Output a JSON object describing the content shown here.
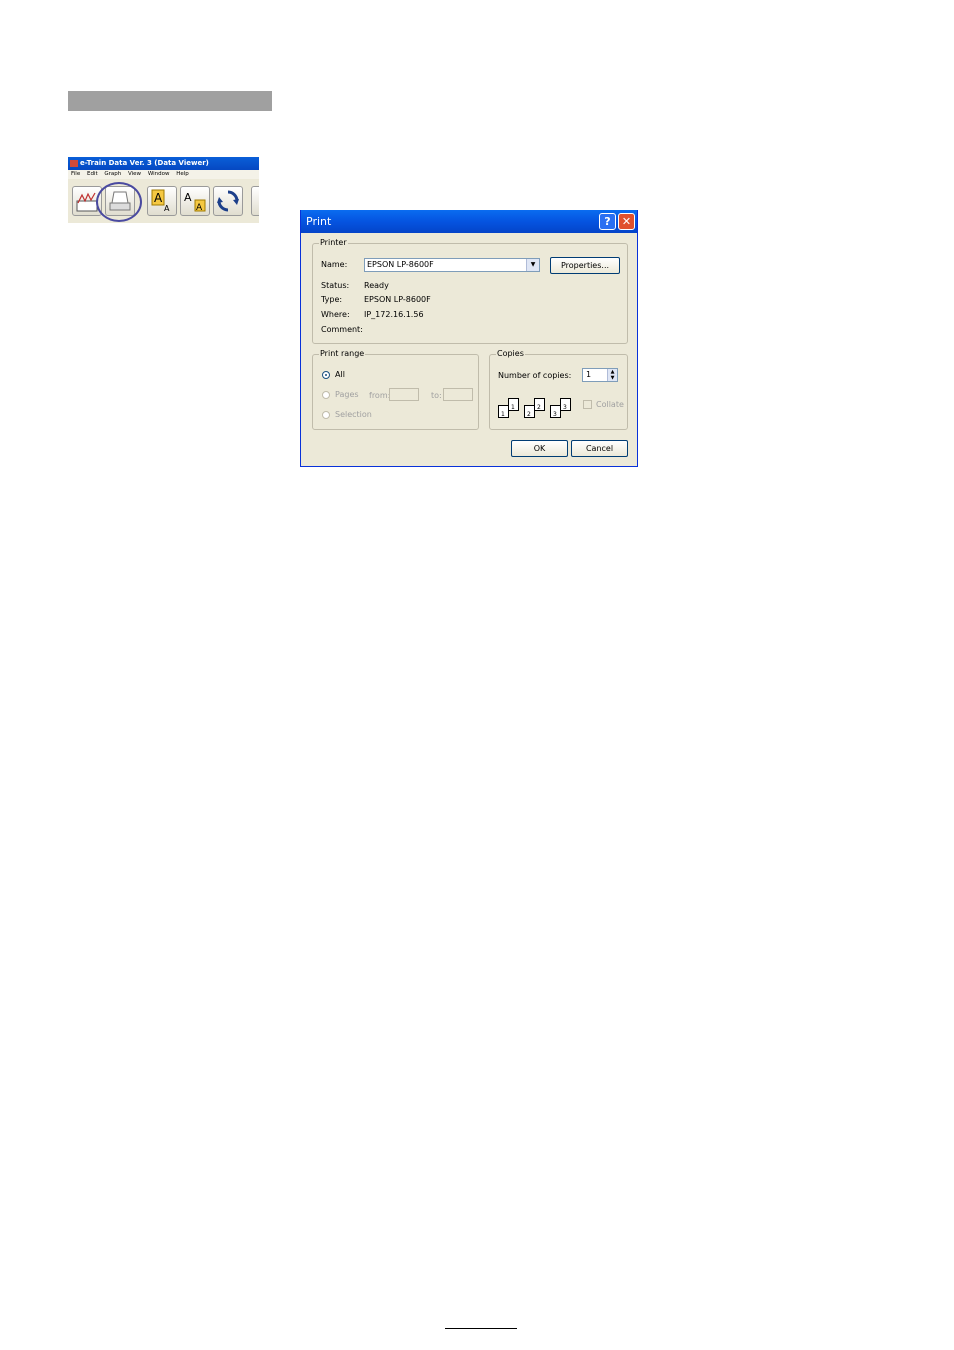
{
  "app": {
    "title": "e-Train Data Ver. 3 (Data Viewer)",
    "menu": [
      "File",
      "Edit",
      "Graph",
      "View",
      "Window",
      "Help"
    ],
    "toolbar": [
      "graph-icon",
      "print-icon",
      "font-size-icon",
      "font-color-icon",
      "refresh-icon"
    ]
  },
  "dialog": {
    "title": "Print",
    "help_symbol": "?",
    "close_symbol": "✕",
    "printer": {
      "legend": "Printer",
      "name_label": "Name:",
      "name_value": "EPSON LP-8600F",
      "properties_label": "Properties...",
      "status_label": "Status:",
      "status_value": "Ready",
      "type_label": "Type:",
      "type_value": "EPSON LP-8600F",
      "where_label": "Where:",
      "where_value": "IP_172.16.1.56",
      "comment_label": "Comment:"
    },
    "print_range": {
      "legend": "Print range",
      "all_label": "All",
      "pages_label": "Pages",
      "from_label": "from:",
      "to_label": "to:",
      "selection_label": "Selection",
      "selected": "All"
    },
    "copies": {
      "legend": "Copies",
      "number_label": "Number of copies:",
      "number_value": "1",
      "collate_label": "Collate",
      "page_numbers": [
        "1",
        "1",
        "2",
        "2",
        "3",
        "3"
      ]
    },
    "ok_label": "OK",
    "cancel_label": "Cancel"
  }
}
